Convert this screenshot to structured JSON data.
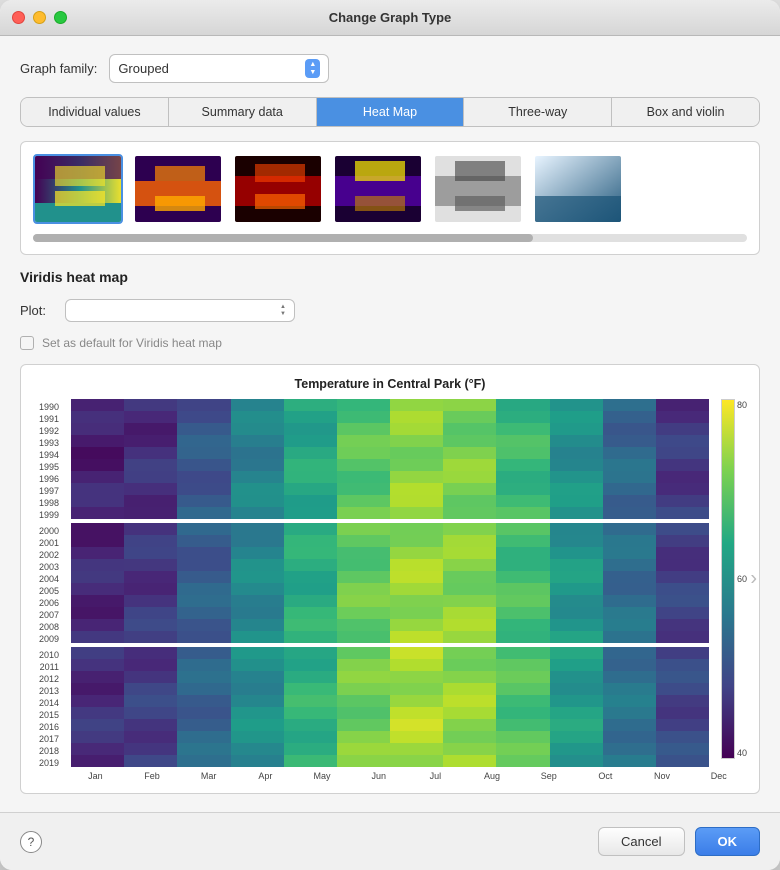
{
  "window": {
    "title": "Change Graph Type"
  },
  "graph_family": {
    "label": "Graph family:",
    "value": "Grouped"
  },
  "tabs": [
    {
      "id": "individual",
      "label": "Individual values",
      "active": false
    },
    {
      "id": "summary",
      "label": "Summary data",
      "active": false
    },
    {
      "id": "heatmap",
      "label": "Heat Map",
      "active": true
    },
    {
      "id": "threeway",
      "label": "Three-way",
      "active": false
    },
    {
      "id": "boxviolin",
      "label": "Box and violin",
      "active": false
    }
  ],
  "section": {
    "title": "Viridis heat map",
    "plot_label": "Plot:",
    "plot_value": "",
    "checkbox_label": "Set as default for Viridis heat map",
    "checkbox_checked": false
  },
  "chart": {
    "title": "Temperature in Central Park (°F)",
    "months": [
      "Jan",
      "Feb",
      "Mar",
      "Apr",
      "May",
      "Jun",
      "Jul",
      "Aug",
      "Sep",
      "Oct",
      "Nov",
      "Dec"
    ],
    "scale_high": "80",
    "scale_mid": "60",
    "scale_low": "40",
    "years_group1": [
      "1990",
      "1991",
      "1992",
      "1993",
      "1994",
      "1995",
      "1996",
      "1997",
      "1998",
      "1999"
    ],
    "years_group2": [
      "2000",
      "2001",
      "2002",
      "2003",
      "2004",
      "2005",
      "2006",
      "2007",
      "2008",
      "2009"
    ],
    "years_group3": [
      "2010",
      "2011",
      "2012",
      "2013",
      "2014",
      "2015",
      "2016",
      "2017",
      "2018",
      "2019"
    ]
  },
  "buttons": {
    "help": "?",
    "cancel": "Cancel",
    "ok": "OK"
  },
  "thumbnails": [
    {
      "id": "t1",
      "selected": true
    },
    {
      "id": "t2",
      "selected": false
    },
    {
      "id": "t3",
      "selected": false
    },
    {
      "id": "t4",
      "selected": false
    },
    {
      "id": "t5",
      "selected": false
    },
    {
      "id": "t6",
      "selected": false
    }
  ]
}
